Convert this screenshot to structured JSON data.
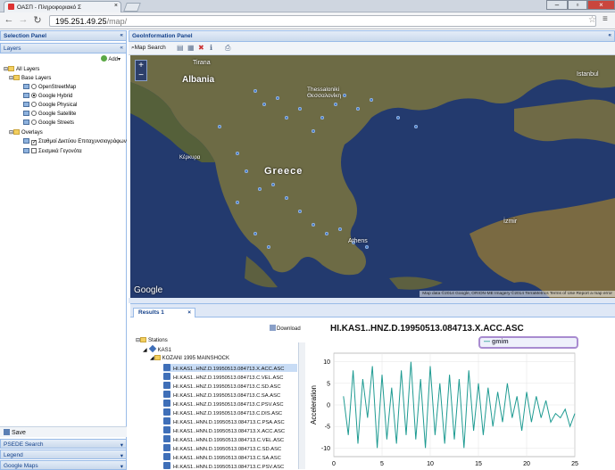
{
  "browser": {
    "tab_title": "ΟΑΣΠ - Πληροφοριακό Σ",
    "url_host": "195.251.49.25",
    "url_path": "/map/"
  },
  "left_panel": {
    "title": "Selection Panel",
    "layers_header": "Layers",
    "add_button": "Add",
    "tree": {
      "all_layers": "All Layers",
      "base_layers": "Base Layers",
      "base_items": [
        "OpenStreetMap",
        "Google Hybrid",
        "Google Physical",
        "Google Satellite",
        "Google Streets"
      ],
      "overlays": "Overlays",
      "overlay_items": [
        "Σταθμοί Δικτύου Επιταχυνσιογράφων",
        "Σεισμικά Γεγονότα"
      ]
    },
    "save_button": "Save",
    "accordion": [
      "PSEDE Search",
      "Legend",
      "Google Maps"
    ]
  },
  "geo_panel": {
    "title": "GeoInformation Panel",
    "map_search": "Map Search",
    "labels": {
      "albania": "Albania",
      "greece": "Greece",
      "thessaloniki": "Thessaloniki\nΘεσσαλονίκη",
      "athens": "Athens",
      "istanbul": "Istanbul",
      "izmir": "İzmir",
      "tirana": "Tirana",
      "corfu": "Κέρκυρα",
      "google": "Google"
    },
    "attribution": "Map data ©2014 Google, ORION-ME Imagery ©2014 TerraMetrics   Terms of Use   Report a map error",
    "zoom_in": "+",
    "zoom_out": "−"
  },
  "results": {
    "tab_label": "Results 1",
    "download": "Download",
    "tree_root": "Stations",
    "station": "KAS1",
    "event": "KOZANI 1995 MAINSHOCK",
    "rows": [
      "HI.KAS1..HNZ.D.19950513.084713.X.ACC.ASC",
      "HI.KAS1..HNZ.D.19950513.084713.C.VEL.ASC",
      "HI.KAS1..HNZ.D.19950513.084713.C.SD.ASC",
      "HI.KAS1..HNZ.D.19950513.084713.C.SA.ASC",
      "HI.KAS1..HNZ.D.19950513.084713.C.PSV.ASC",
      "HI.KAS1..HNZ.D.19950513.084713.C.DIS.ASC",
      "HI.KAS1..HNN.D.19950513.084713.C.PSA.ASC",
      "HI.KAS1..HNN.D.19950513.084713.X.ACC.ASC",
      "HI.KAS1..HNN.D.19950513.084713.C.VEL.ASC",
      "HI.KAS1..HNN.D.19950513.084713.C.SD.ASC",
      "HI.KAS1..HNN.D.19950513.084713.C.SA.ASC",
      "HI.KAS1..HNN.D.19950513.084713.C.PSV.ASC"
    ]
  },
  "chart_data": {
    "type": "line",
    "title": "HI.KAS1..HNZ.D.19950513.084713.X.ACC.ASC",
    "xlabel": "",
    "ylabel": "Acceleration",
    "legend": "gmim",
    "legend_position": "top-right",
    "xlim": [
      0,
      25
    ],
    "ylim": [
      -12,
      12
    ],
    "xticks": [
      0,
      5,
      10,
      15,
      20,
      25
    ],
    "yticks": [
      10,
      5,
      0,
      -5,
      -10
    ],
    "grid": true,
    "color": "#1f9b92",
    "series": [
      {
        "name": "gmim",
        "x": [
          1,
          1.5,
          2,
          2.5,
          3,
          3.5,
          4,
          4.5,
          5,
          5.5,
          6,
          6.5,
          7,
          7.5,
          8,
          8.5,
          9,
          9.5,
          10,
          10.5,
          11,
          11.5,
          12,
          12.5,
          13,
          13.5,
          14,
          14.5,
          15,
          15.5,
          16,
          16.5,
          17,
          17.5,
          18,
          18.5,
          19,
          19.5,
          20,
          20.5,
          21,
          21.5,
          22,
          22.5,
          23,
          23.5,
          24,
          24.5,
          25
        ],
        "values": [
          2,
          -7,
          8,
          -9,
          6,
          -3,
          9,
          -10,
          7,
          -8,
          4,
          -9,
          8,
          -7,
          10,
          -8,
          6,
          -10,
          9,
          -7,
          5,
          -9,
          7,
          -8,
          6,
          -10,
          8,
          -6,
          5,
          -7,
          4,
          -5,
          3,
          -4,
          5,
          -3,
          2,
          -6,
          3,
          -4,
          2,
          -3,
          1,
          -4,
          -2,
          -3,
          -1,
          -5,
          -2
        ]
      }
    ]
  }
}
